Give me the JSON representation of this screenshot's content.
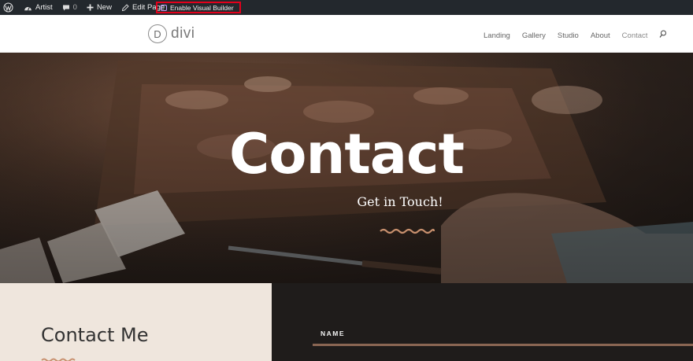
{
  "adminbar": {
    "site_name": "Artist",
    "comments_count": "0",
    "new_label": "New",
    "edit_label": "Edit Page",
    "visual_builder_label": "Enable Visual Builder",
    "icons": [
      "wordpress-icon",
      "dashboard-icon",
      "comment-icon",
      "plus-icon",
      "pencil-icon",
      "visual-builder-icon"
    ]
  },
  "header": {
    "logo_letter": "D",
    "logo_text": "divi",
    "nav": [
      "Landing",
      "Gallery",
      "Studio",
      "About",
      "Contact"
    ],
    "active": "Contact"
  },
  "hero": {
    "title": "Contact",
    "subtitle": "Get in Touch!"
  },
  "contact": {
    "heading": "Contact Me",
    "name_label": "NAME"
  },
  "colors": {
    "admin_bar": "#23282d",
    "highlight_box": "#e3001b",
    "accent_wave": "#c8906e",
    "left_panel": "#efe6dd",
    "right_panel": "#1f1c1b",
    "field_line": "#8a6653"
  }
}
